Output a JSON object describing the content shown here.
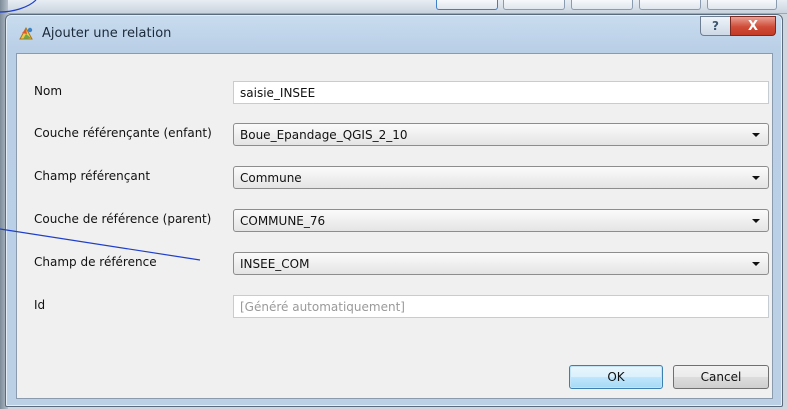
{
  "dialog": {
    "title": "Ajouter une relation",
    "help_glyph": "?",
    "close_glyph": "X"
  },
  "fields": {
    "nom": {
      "label": "Nom",
      "value": "saisie_INSEE"
    },
    "couche_referencante": {
      "label": "Couche référençante (enfant)",
      "value": "Boue_Epandage_QGIS_2_10"
    },
    "champ_referencant": {
      "label": "Champ référençant",
      "value": "Commune"
    },
    "couche_reference": {
      "label": "Couche de référence (parent)",
      "value": "COMMUNE_76"
    },
    "champ_reference": {
      "label": "Champ de référence",
      "value": "INSEE_COM"
    },
    "id": {
      "label": "Id",
      "placeholder": "[Généré automatiquement]"
    }
  },
  "buttons": {
    "ok": "OK",
    "cancel": "Cancel"
  },
  "icons": {
    "app": "qgis-relation-icon",
    "help": "help-icon",
    "close": "close-icon",
    "dropdown": "chevron-down-icon"
  },
  "colors": {
    "annotation_line": "#1f3fc8",
    "ok_border": "#3c7fb1",
    "close_red": "#c43b25"
  }
}
